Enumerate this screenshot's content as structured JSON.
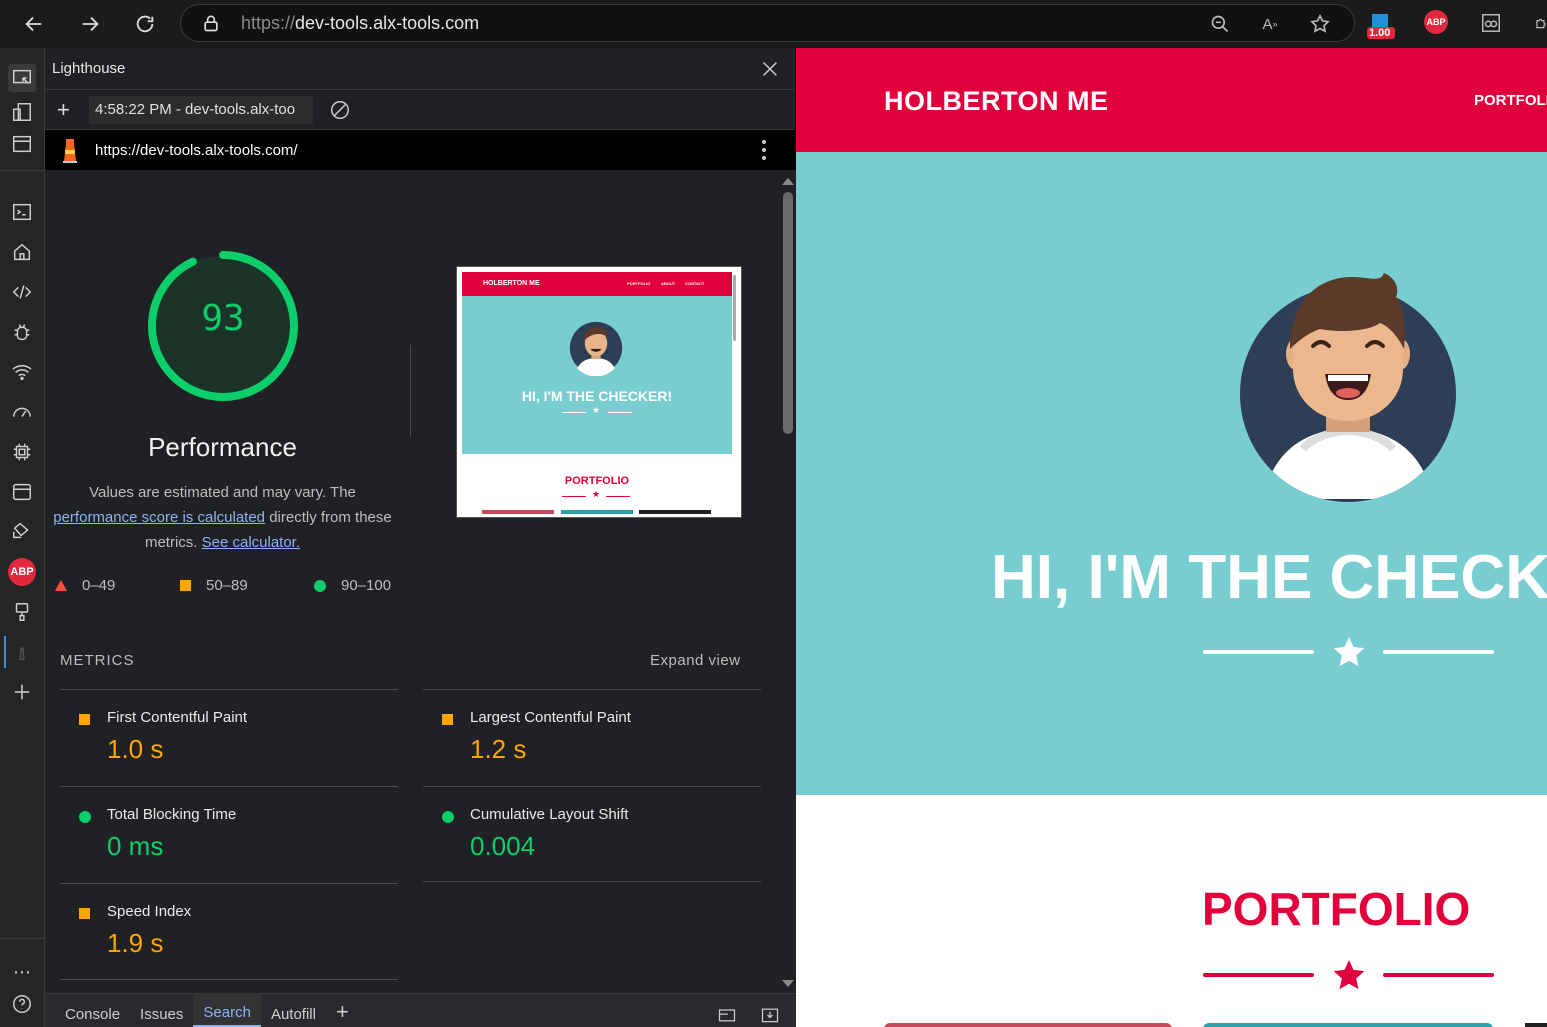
{
  "browser": {
    "url_prefix": "https://",
    "url_host": "dev-tools.alx-tools.com",
    "extension_badge": "1.00",
    "abp_label": "ABP"
  },
  "devtools": {
    "panel_title": "Lighthouse",
    "report_label": "4:58:22 PM - dev-tools.alx-too",
    "audited_url": "https://dev-tools.alx-tools.com/",
    "score": "93",
    "category": "Performance",
    "desc_prefix": "Values are estimated and may vary. The",
    "desc_link": "performance score is calculated",
    "desc_middle": "directly from these metrics.",
    "desc_link2": "See calculator.",
    "legend": {
      "fail": "0–49",
      "average": "50–89",
      "pass": "90–100"
    },
    "metrics_heading": "METRICS",
    "expand_label": "Expand view",
    "metrics": [
      {
        "name": "First Contentful Paint",
        "value": "1.0 s",
        "rating": "average"
      },
      {
        "name": "Largest Contentful Paint",
        "value": "1.2 s",
        "rating": "average"
      },
      {
        "name": "Total Blocking Time",
        "value": "0 ms",
        "rating": "pass"
      },
      {
        "name": "Cumulative Layout Shift",
        "value": "0.004",
        "rating": "pass"
      },
      {
        "name": "Speed Index",
        "value": "1.9 s",
        "rating": "average"
      }
    ],
    "drawer_tabs": [
      "Console",
      "Issues",
      "Search",
      "Autofill"
    ],
    "active_drawer_tab": "Search"
  },
  "thumbnail": {
    "brand": "HOLBERTON ME",
    "links": [
      "PORTFOLIO",
      "ABOUT",
      "CONTACT"
    ],
    "hero": "HI, I'M THE CHECKER!",
    "section": "PORTFOLIO"
  },
  "webpage": {
    "brand": "HOLBERTON ME",
    "nav_link": "PORTFOLIO",
    "hero_title": "HI, I'M THE CHECKER!",
    "section_title": "PORTFOLIO"
  },
  "colors": {
    "brand_red": "#e0003c",
    "hero_teal": "#78cdd1",
    "score_green": "#0cce6b",
    "score_orange": "#ffa400",
    "score_red": "#ff4e42"
  }
}
